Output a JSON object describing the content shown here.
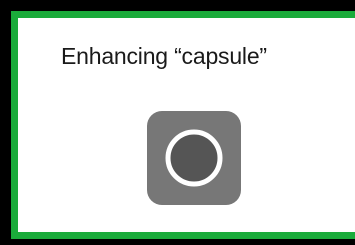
{
  "dialog": {
    "title": "Enhancing “capsule”",
    "accent_color": "#1aab3a",
    "background_color": "#ffffff"
  },
  "spinner": {
    "icon": "progress-circle-icon",
    "box_color": "#777777",
    "ring_color": "#ffffff",
    "fill_color": "#555555"
  }
}
